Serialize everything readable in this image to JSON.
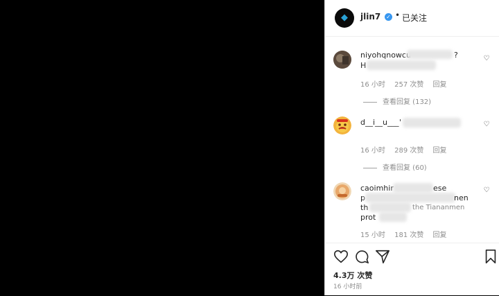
{
  "post": {
    "username": "jlin7",
    "follow_status": "已关注",
    "separator": "•"
  },
  "comments": [
    {
      "user": "niyohqnowcu",
      "user_tail": "?",
      "text_start": "H",
      "time": "16 小时",
      "likes": "257 次赞",
      "reply": "回复",
      "view_replies": "查看回复 (132)"
    },
    {
      "user": "d__i__u___",
      "user_tail": "'",
      "time": "16 小时",
      "likes": "289 次赞",
      "reply": "回复",
      "view_replies": "查看回复 (60)"
    },
    {
      "user": "caoimhir",
      "user_tail": "ese",
      "line2_start": "p",
      "line2_end": "nen",
      "line3_start": "th",
      "line3_mid": "the Tiananmen",
      "line4_start": "prot",
      "time": "15 小时",
      "likes": "181 次赞",
      "reply": "回复"
    }
  ],
  "footer": {
    "likes": "4.3万 次赞",
    "time": "16 小时前"
  },
  "icons": {
    "heart": "heart-icon",
    "comment": "comment-icon",
    "share": "share-icon",
    "save": "bookmark-icon"
  }
}
